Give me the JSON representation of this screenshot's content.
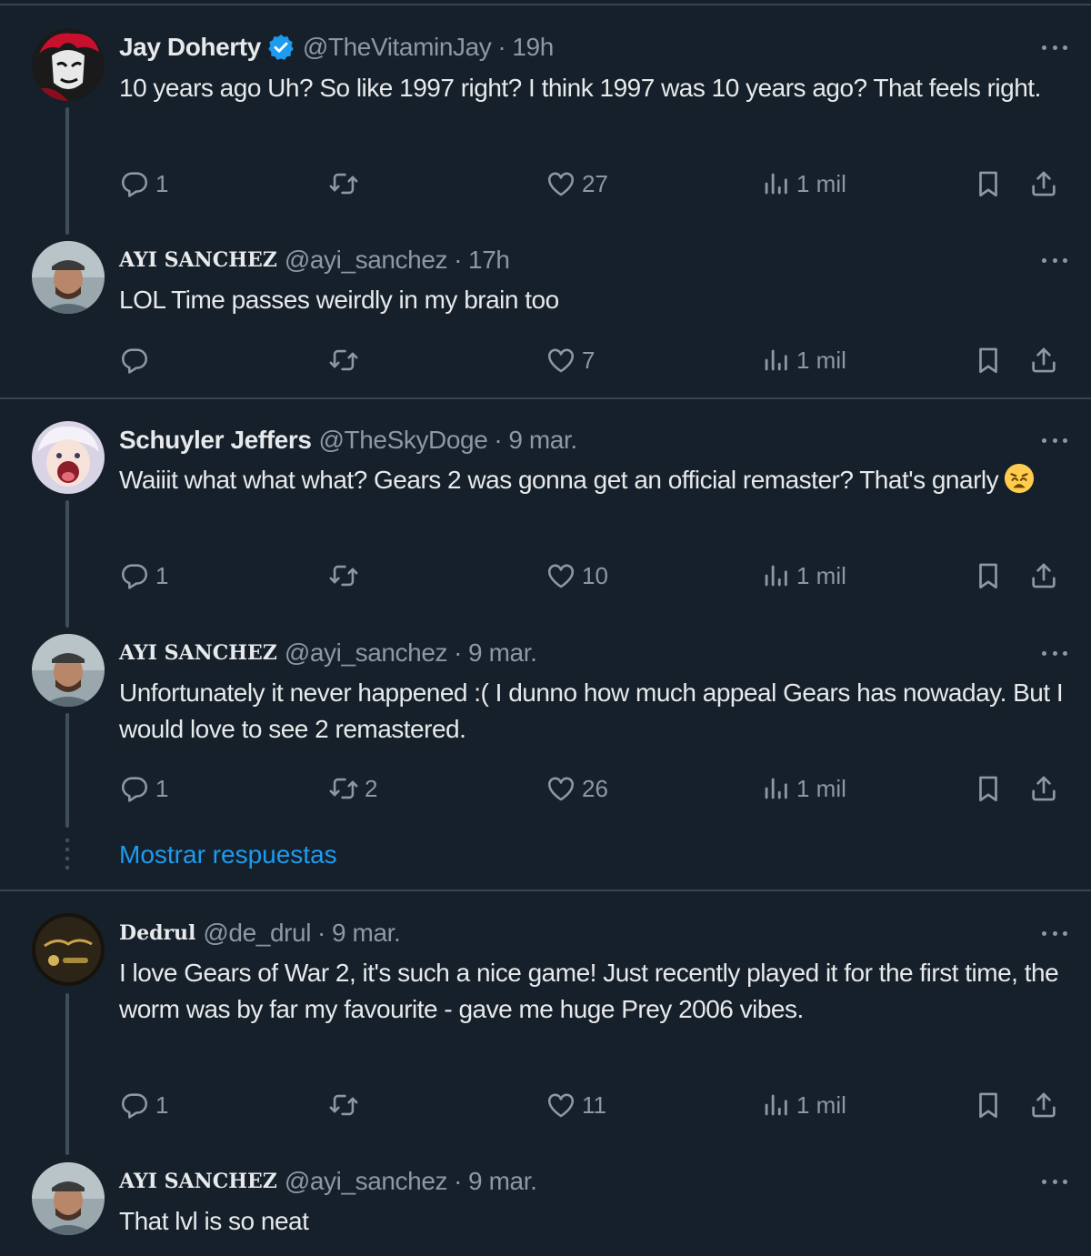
{
  "theme": {
    "background": "#15202b",
    "text": "#e7e9ea",
    "muted": "#8b98a5",
    "accent": "#1d9bf0",
    "divider": "#38444d",
    "verified": "#1d9bf0"
  },
  "tweets": [
    {
      "name": "Jay Doherty",
      "verified": true,
      "handle": "@TheVitaminJay",
      "separator": "·",
      "time": "19h",
      "text": "10 years ago Uh? So like 1997 right? I think 1997 was 10 years ago? That feels right.",
      "reply_count": "1",
      "retweet_count": "",
      "like_count": "27",
      "view_count": "1 mil",
      "avatar": "jay-doherty-avatar"
    },
    {
      "name": "AYI SANCHEZ",
      "handle": "@ayi_sanchez",
      "separator": "·",
      "time": "17h",
      "text": "LOL Time passes weirdly in my brain too",
      "reply_count": "",
      "retweet_count": "",
      "like_count": "7",
      "view_count": "1 mil",
      "avatar": "ayi-sanchez-avatar"
    },
    {
      "name": "Schuyler Jeffers",
      "handle": "@TheSkyDoge",
      "separator": "·",
      "time": "9 mar.",
      "text": "Waiiit what what what? Gears 2 was gonna get an official remaster? That's gnarly",
      "emoji": "weary-face-emoji",
      "reply_count": "1",
      "retweet_count": "",
      "like_count": "10",
      "view_count": "1 mil",
      "avatar": "schuyler-jeffers-avatar"
    },
    {
      "name": "AYI SANCHEZ",
      "handle": "@ayi_sanchez",
      "separator": "·",
      "time": "9 mar.",
      "text": "Unfortunately it never happened :( I dunno how much appeal Gears has nowaday. But I would love to see 2 remastered.",
      "reply_count": "1",
      "retweet_count": "2",
      "like_count": "26",
      "view_count": "1 mil",
      "avatar": "ayi-sanchez-avatar"
    },
    {
      "name": "Dedrul",
      "handle": "@de_drul",
      "separator": "·",
      "time": "9 mar.",
      "text": "I love Gears of War 2, it's such a nice game! Just recently played it for the first time, the worm was by far my favourite - gave me huge Prey 2006 vibes.",
      "reply_count": "1",
      "retweet_count": "",
      "like_count": "11",
      "view_count": "1 mil",
      "avatar": "dedrul-avatar"
    },
    {
      "name": "AYI SANCHEZ",
      "handle": "@ayi_sanchez",
      "separator": "·",
      "time": "9 mar.",
      "text": "That lvl is so neat",
      "avatar": "ayi-sanchez-avatar"
    }
  ],
  "show_replies_label": "Mostrar respuestas",
  "icons": {
    "reply": "reply-icon",
    "retweet": "retweet-icon",
    "like": "heart-icon",
    "views": "views-icon",
    "bookmark": "bookmark-icon",
    "share": "share-icon",
    "more": "more-dots-icon",
    "verified": "verified-badge-icon"
  }
}
